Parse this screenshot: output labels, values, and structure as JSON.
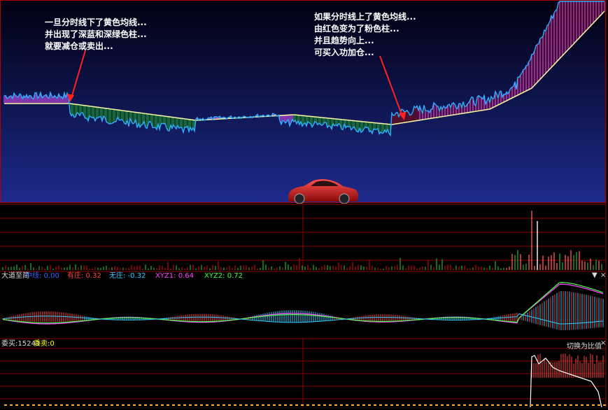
{
  "annotations": {
    "left_note": "一旦分时线下了黄色均线...\n并出现了深蓝和深绿色柱...\n就要减仓或卖出...",
    "right_note": "如果分时线上了黄色均线...\n由红色变为了粉色柱...\n并且趋势向上...\n可买入功加仓..."
  },
  "indicator_panel": {
    "name": "大道至简",
    "fields": [
      {
        "label": "中线",
        "value": "0.00",
        "color": "#3366ff"
      },
      {
        "label": "有庄",
        "value": "0.32",
        "color": "#ff4444"
      },
      {
        "label": "无庄",
        "value": "-0.32",
        "color": "#33ccff"
      },
      {
        "label": "XYZ1",
        "value": "0.64",
        "color": "#ff44ff"
      },
      {
        "label": "XYZ2",
        "value": "0.72",
        "color": "#44ff44"
      }
    ],
    "dropdown_icon": "triangle-down-icon",
    "close_icon": "close-icon"
  },
  "bottom_panel": {
    "buy_label": "委买:15243",
    "sell_label": "委卖:0",
    "switch_label": "切换为比值",
    "close_icon": "close-icon"
  },
  "colors": {
    "main_bg_top": "#000010",
    "main_bg_bottom": "#1e2a8c",
    "price_line": "#2ab0ff",
    "avg_line": "#f0f0a0",
    "pink_bar": "#d04cf0",
    "dark_red_bar": "#7a0a10",
    "green_bar": "#1e9a2a",
    "grid_red": "#8a0000",
    "buy_color": "#dddddd",
    "sell_color": "#ffff00"
  }
}
